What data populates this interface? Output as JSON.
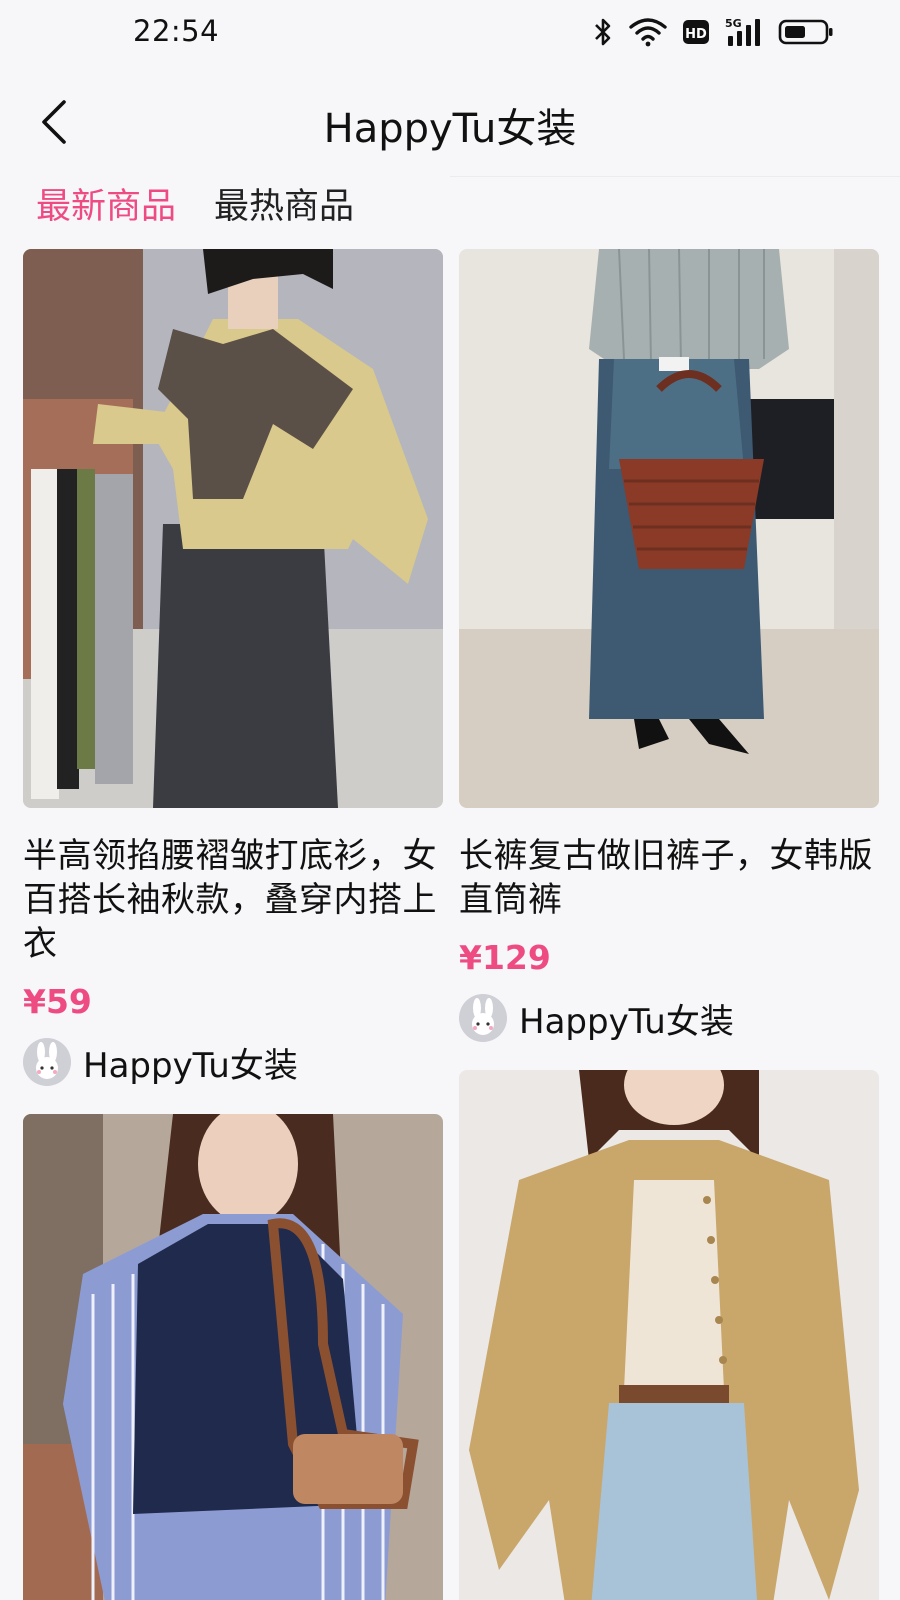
{
  "status_bar": {
    "time": "22:54",
    "icons": [
      "bluetooth-icon",
      "wifi-icon",
      "hd-icon",
      "5g-signal-icon",
      "battery-icon"
    ],
    "network_label": "5G",
    "hd_label": "HD"
  },
  "header": {
    "title": "HappyTu女装",
    "back_icon": "chevron-left-icon"
  },
  "tabs": [
    {
      "label": "最新商品",
      "active": true
    },
    {
      "label": "最热商品",
      "active": false
    }
  ],
  "colors": {
    "accent": "#ef4b83",
    "background": "#f7f7f9",
    "text": "#111111"
  },
  "products": [
    {
      "title": "半高领掐腰褶皱打底衫，女百搭长袖秋款，叠穿内搭上衣",
      "price": "¥59",
      "shop": "HappyTu女装"
    },
    {
      "title": "长裤复古做旧裤子，女韩版直筒裤",
      "price": "¥129",
      "shop": "HappyTu女装"
    },
    {
      "title": "",
      "price": "",
      "shop": ""
    },
    {
      "title": "",
      "price": "",
      "shop": ""
    }
  ]
}
